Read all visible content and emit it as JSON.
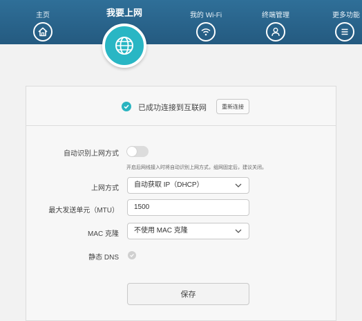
{
  "nav": {
    "home": "主页",
    "internet": "我要上网",
    "wifi": "我的 Wi-Fi",
    "terminals": "终端管理",
    "more": "更多功能"
  },
  "status": {
    "text": "已成功连接到互联网",
    "reconnect": "重新连接"
  },
  "form": {
    "auto_detect_label": "自动识别上网方式",
    "auto_detect_on": false,
    "hint": "开启后网线接入时将自动识别上网方式，组网固定后，建议关闭。",
    "mode_label": "上网方式",
    "mode_value": "自动获取 IP（DHCP）",
    "mtu_label": "最大发送单元（MTU）",
    "mtu_value": "1500",
    "mac_label": "MAC 克隆",
    "mac_value": "不使用 MAC 克隆",
    "dns_label": "静态 DNS",
    "save": "保存"
  },
  "colors": {
    "nav_bg": "#2a6489",
    "accent": "#29b6c4"
  }
}
